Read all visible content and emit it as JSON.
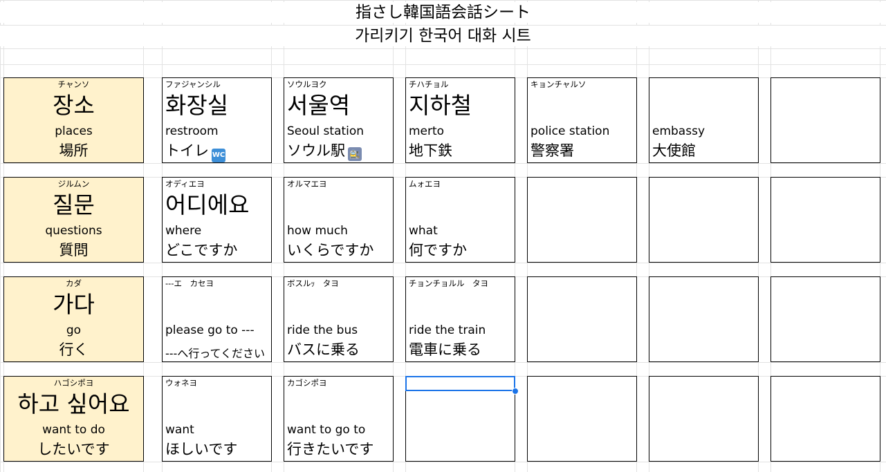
{
  "title_jp": "指さし韓国語会話シート",
  "title_ko": "가리키기 한국어 대화 시트",
  "rows": [
    {
      "head": {
        "kana": "チャンソ",
        "ko": "장소",
        "en": "places",
        "ja": "場所"
      },
      "cells": [
        {
          "kana": "ファジャンシル",
          "ko": "화장실",
          "en": "restroom",
          "ja": "トイレ",
          "emoji": "wc-icon"
        },
        {
          "kana": "ソウルヨク",
          "ko": "서울역",
          "en": "Seoul station",
          "ja": "ソウル駅",
          "emoji": "station-icon"
        },
        {
          "kana": "チハチョル",
          "ko": "지하철",
          "en": "merto",
          "ja": "地下鉄"
        },
        {
          "kana": "キョンチャルソ",
          "ko": "",
          "en": "police station",
          "ja": "警察署"
        },
        {
          "kana": "",
          "ko": "",
          "en": "embassy",
          "ja": "大使館"
        },
        {
          "kana": "",
          "ko": "",
          "en": "",
          "ja": ""
        }
      ]
    },
    {
      "head": {
        "kana": "ジルムン",
        "ko": "질문",
        "en": "questions",
        "ja": "質問"
      },
      "cells": [
        {
          "kana": "オディエヨ",
          "ko": "어디에요",
          "en": "where",
          "ja": "どこですか"
        },
        {
          "kana": "オルマエヨ",
          "ko": "",
          "en": "how much",
          "ja": "いくらですか"
        },
        {
          "kana": "ムォエヨ",
          "ko": "",
          "en": "what",
          "ja": "何ですか"
        },
        {
          "kana": "",
          "ko": "",
          "en": "",
          "ja": ""
        },
        {
          "kana": "",
          "ko": "",
          "en": "",
          "ja": ""
        },
        {
          "kana": "",
          "ko": "",
          "en": "",
          "ja": ""
        }
      ]
    },
    {
      "head": {
        "kana": "カダ",
        "ko": "가다",
        "en": "go",
        "ja": "行く"
      },
      "cells": [
        {
          "kana": "---エ　カセヨ",
          "ko": "",
          "en": "please go to ---",
          "ja": "---へ行ってください",
          "ja_small": true
        },
        {
          "kana": "ボスルｯ　タヨ",
          "ko": "",
          "en": "ride the bus",
          "ja": "バスに乗る"
        },
        {
          "kana": "チョンチョルル　タヨ",
          "ko": "",
          "en": "ride the train",
          "ja": "電車に乗る"
        },
        {
          "kana": "",
          "ko": "",
          "en": "",
          "ja": ""
        },
        {
          "kana": "",
          "ko": "",
          "en": "",
          "ja": ""
        },
        {
          "kana": "",
          "ko": "",
          "en": "",
          "ja": ""
        }
      ]
    },
    {
      "head": {
        "kana": "ハゴシポヨ",
        "ko": "하고 싶어요",
        "en": "want to do",
        "ja": "したいです"
      },
      "cells": [
        {
          "kana": "ウォネヨ",
          "ko": "",
          "en": "want",
          "ja": "ほしいです"
        },
        {
          "kana": "カゴシポヨ",
          "ko": "",
          "en": "want to go to",
          "ja": "行きたいです"
        },
        {
          "kana": "",
          "ko": "",
          "en": "",
          "ja": ""
        },
        {
          "kana": "",
          "ko": "",
          "en": "",
          "ja": ""
        },
        {
          "kana": "",
          "ko": "",
          "en": "",
          "ja": ""
        },
        {
          "kana": "",
          "ko": "",
          "en": "",
          "ja": ""
        }
      ]
    }
  ],
  "selection_color": "#1a73e8",
  "header_fill": "#fff2cc"
}
